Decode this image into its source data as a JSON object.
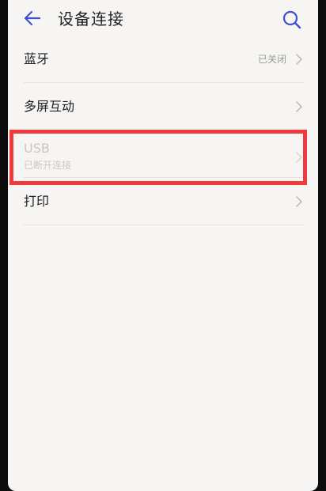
{
  "header": {
    "title": "设备连接",
    "back_icon": "back-arrow-icon",
    "search_icon": "search-icon"
  },
  "rows": [
    {
      "label": "蓝牙",
      "value": "已关闭",
      "icon": "chevron-right-icon"
    },
    {
      "label": "多屏互动",
      "icon": "chevron-right-icon"
    },
    {
      "label": "USB",
      "sublabel": "已断开连接",
      "disabled": true,
      "icon": "chevron-right-icon"
    },
    {
      "label": "打印",
      "icon": "chevron-right-icon"
    }
  ],
  "colors": {
    "accent": "#3e4fd1",
    "highlight": "#f03b3e",
    "background": "#f7f5f3",
    "text_primary": "#1f1f1f",
    "text_secondary": "#9a9a9a",
    "text_disabled": "#c9c6c4"
  }
}
